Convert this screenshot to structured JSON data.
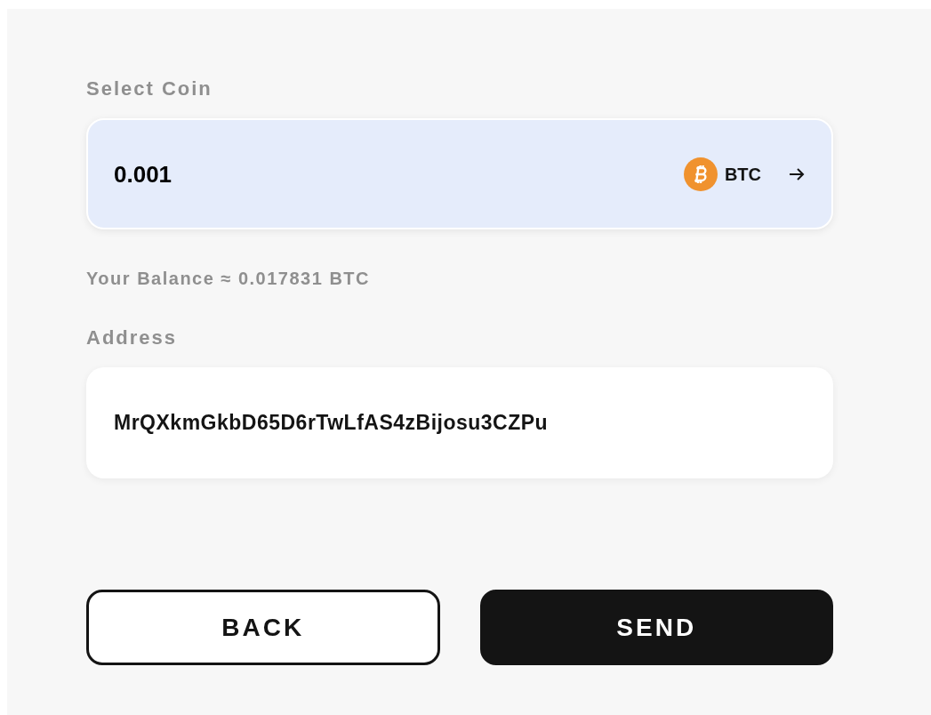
{
  "coin_label": "Select Coin",
  "amount": {
    "value": "0.001",
    "coin": "BTC"
  },
  "balance": "Your Balance ≈ 0.017831 BTC",
  "address_label": "Address",
  "address": {
    "value": "MrQXkmGkbD65D6rTwLfAS4zBijosu3CZPu"
  },
  "buttons": [
    {
      "label": "BACK",
      "kind": "outline"
    },
    {
      "label": "SEND",
      "kind": "filled"
    }
  ]
}
